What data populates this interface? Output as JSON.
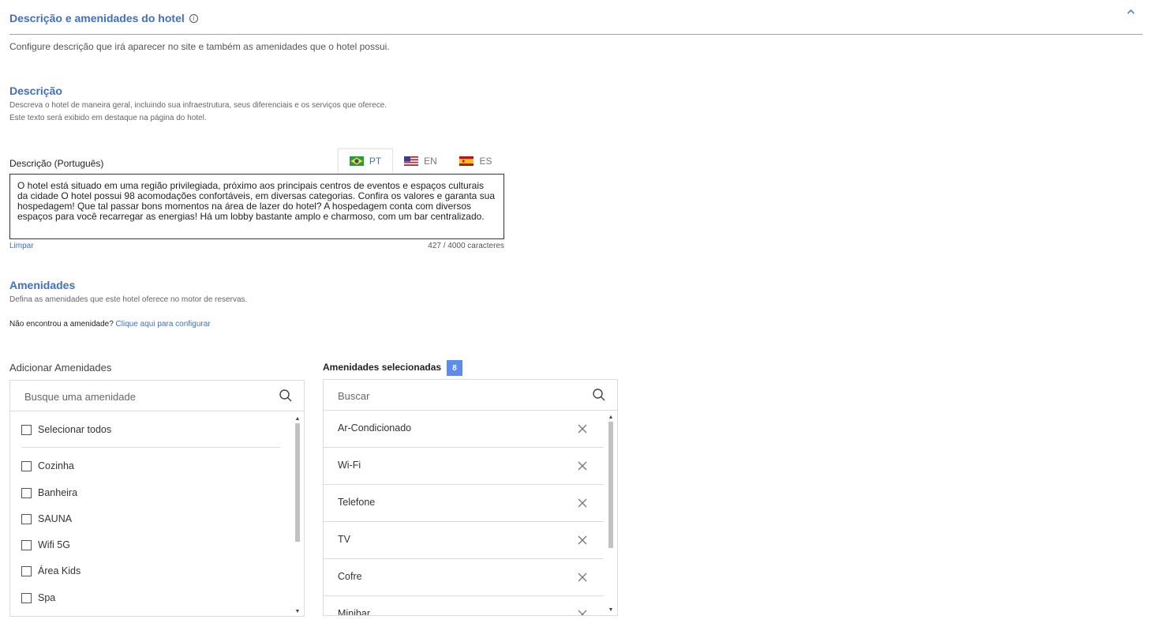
{
  "section": {
    "title": "Descrição e amenidades do hotel",
    "info_glyph": "i",
    "subtitle": "Configure descrição que irá aparecer no site e também as amenidades que o hotel possui."
  },
  "description": {
    "title": "Descrição",
    "help_line1": "Descreva o hotel de maneira geral, incluindo sua infraestrutura, seus diferenciais e os serviços que oferece.",
    "help_line2": "Este texto será exibido em destaque na página do hotel.",
    "field_label": "Descrição (Português)",
    "tabs": [
      {
        "code": "PT",
        "flag": "brazil-flag-icon",
        "active": true
      },
      {
        "code": "EN",
        "flag": "usa-flag-icon",
        "active": false
      },
      {
        "code": "ES",
        "flag": "spain-flag-icon",
        "active": false
      }
    ],
    "text": "O hotel está situado em uma região privilegiada, próximo aos principais centros de eventos e espaços culturais da cidade O hotel possui 98 acomodações confortáveis, em diversas categorias. Confira os valores e garanta sua hospedagem! Que tal passar bons momentos na área de lazer do hotel? A hospedagem conta com diversos espaços para você recarregar as energias! Há um lobby bastante amplo e charmoso, com um bar centralizado.",
    "clear_label": "Limpar",
    "char_count": "427 / 4000 caracteres"
  },
  "amenities": {
    "title": "Amenidades",
    "help": "Defina as amenidades que este hotel oferece no motor de reservas.",
    "not_found_text": "Não encontrou a amenidade?",
    "not_found_link": "Clique aqui para configurar",
    "add_label": "Adicionar Amenidades",
    "add_search_placeholder": "Busque uma amenidade",
    "select_all": "Selecionar todos",
    "available": [
      "Cozinha",
      "Banheira",
      "SAUNA",
      "Wifi 5G",
      "Área Kids",
      "Spa"
    ],
    "selected_label": "Amenidades selecionadas",
    "selected_count": "8",
    "selected_search_placeholder": "Buscar",
    "selected": [
      "Ar-Condicionado",
      "Wi-Fi",
      "Telefone",
      "TV",
      "Cofre",
      "Minibar"
    ]
  },
  "colors": {
    "accent": "#3b6fd4",
    "badge": "#5b8def"
  }
}
